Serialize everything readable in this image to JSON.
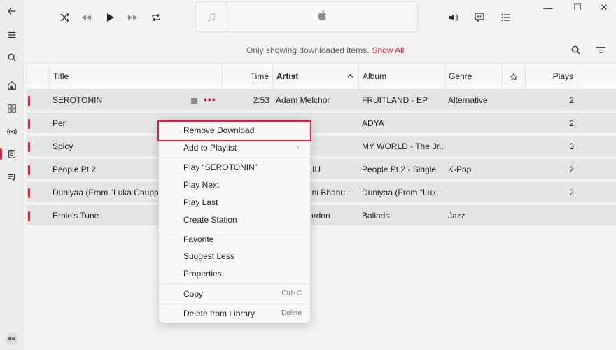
{
  "colors": {
    "accent": "#e0203a",
    "row_bg": "#e4e4e4"
  },
  "icons": {
    "rail": [
      "back-arrow-icon",
      "menu-icon",
      "search-icon",
      "home-icon",
      "browse-grid-icon",
      "radio-icon",
      "library-icon",
      "playlist-icon"
    ],
    "top": [
      "shuffle-icon",
      "rewind-icon",
      "play-icon",
      "fast-forward-icon",
      "repeat-icon",
      "volume-icon",
      "lyrics-icon",
      "queue-list-icon"
    ]
  },
  "avatar": {
    "initials": "BB"
  },
  "window": {
    "minimize": "—",
    "maximize": "☐",
    "close": "✕"
  },
  "subheader": {
    "notice": "Only showing downloaded items.",
    "show_all": "Show All"
  },
  "table": {
    "columns": [
      "Title",
      "Time",
      "Artist",
      "Album",
      "Genre",
      "",
      "Plays"
    ],
    "sort_indicator": "^",
    "rows": [
      {
        "title": "SEROTONIN",
        "time": "2:53",
        "artist": "Adam Melchor",
        "album": "FRUITLAND - EP",
        "genre": "Alternative",
        "plays": "2"
      },
      {
        "title": "Per",
        "time": "",
        "artist": "",
        "album": "ADYA",
        "genre": "",
        "plays": "2"
      },
      {
        "title": "Spicy",
        "time": "",
        "artist": "",
        "album": "MY WORLD - The 3r...",
        "genre": "",
        "plays": "3"
      },
      {
        "title": "People Pt.2",
        "time": "",
        "artist": "IU",
        "album": "People Pt.2 - Single",
        "genre": "K-Pop",
        "plays": "2"
      },
      {
        "title": "Duniyaa (From \"Luka Chuppi\"",
        "time": "",
        "artist": "rani Bhanu...",
        "album": "Duniyaa (From \"Luk...",
        "genre": "",
        "plays": "2"
      },
      {
        "title": "Ernie's Tune",
        "time": "",
        "artist": "ordon",
        "album": "Ballads",
        "genre": "Jazz",
        "plays": ""
      }
    ],
    "more_dots": "•••"
  },
  "menu": {
    "remove_download": "Remove Download",
    "add_to_playlist": "Add to Playlist",
    "chevron": "›",
    "play_item": "Play “SEROTONIN”",
    "play_next": "Play Next",
    "play_last": "Play Last",
    "create_station": "Create Station",
    "favorite": "Favorite",
    "suggest_less": "Suggest Less",
    "properties": "Properties",
    "copy": "Copy",
    "copy_shortcut": "Ctrl+C",
    "delete_from_library": "Delete from Library",
    "delete_shortcut": "Delete"
  }
}
